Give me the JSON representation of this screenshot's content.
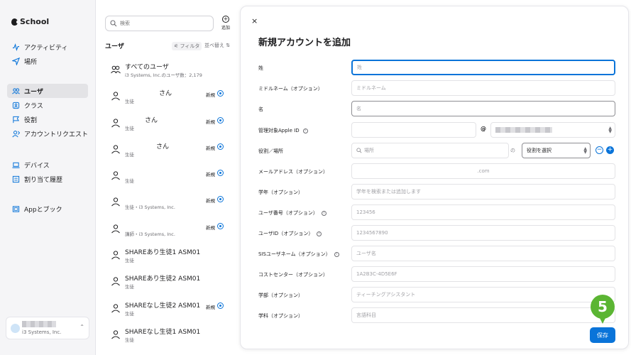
{
  "sidebar": {
    "brand": "School",
    "items": [
      {
        "label": "アクティビティ",
        "icon": "activity-icon"
      },
      {
        "label": "場所",
        "icon": "location-icon"
      },
      {
        "label": "ユーザ",
        "icon": "users-icon",
        "active": true
      },
      {
        "label": "クラス",
        "icon": "class-icon"
      },
      {
        "label": "役割",
        "icon": "flag-icon"
      },
      {
        "label": "アカウントリクエスト",
        "icon": "account-request-icon"
      },
      {
        "label": "デバイス",
        "icon": "laptop-icon"
      },
      {
        "label": "割り当て履歴",
        "icon": "history-icon"
      },
      {
        "label": "Appとブック",
        "icon": "apps-icon"
      }
    ],
    "account": {
      "org": "i3 Systems, Inc."
    }
  },
  "list": {
    "search_placeholder": "検索",
    "add_label": "追加",
    "title": "ユーザ",
    "filter_label": "フィルタ",
    "sort_label": "並べ替え",
    "rows": [
      {
        "name": "すべてのユーザ",
        "sub": "i3 Systems, Inc.のユーザ数：2,179",
        "new": "",
        "group": true
      },
      {
        "name": "さん",
        "sub": "生徒",
        "new": "新規",
        "centered": true
      },
      {
        "name": "さん",
        "sub": "生徒",
        "new": "新規",
        "centered": true
      },
      {
        "name": "さん",
        "sub": "生徒",
        "new": "新規",
        "centered": true
      },
      {
        "name": "",
        "sub": "生徒",
        "new": "新規"
      },
      {
        "name": "",
        "sub": "生徒・i3 Systems, Inc.",
        "new": "新規"
      },
      {
        "name": "",
        "sub": "講師・i3 Systems, Inc.",
        "new": "新規"
      },
      {
        "name": "SHAREあり生徒1 ASM01",
        "sub": "生徒",
        "new": ""
      },
      {
        "name": "SHAREあり生徒2 ASM01",
        "sub": "生徒",
        "new": ""
      },
      {
        "name": "SHAREなし生徒2 ASM01",
        "sub": "生徒",
        "new": "新規"
      },
      {
        "name": "SHAREなし生徒1 ASM01",
        "sub": "生徒",
        "new": ""
      }
    ]
  },
  "modal": {
    "close": "×",
    "title": "新規アカウントを追加",
    "fields": {
      "last_name": {
        "label": "姓",
        "placeholder": "姓"
      },
      "middle_name": {
        "label": "ミドルネーム（オプション）",
        "placeholder": "ミドルネーム"
      },
      "first_name": {
        "label": "名",
        "placeholder": "名"
      },
      "apple_id": {
        "label": "管理対象Apple ID",
        "at": "@"
      },
      "role": {
        "label": "役割／場所",
        "place_placeholder": "場所",
        "no": "の",
        "role_select": "役割を選択"
      },
      "email": {
        "label": "メールアドレス（オプション）",
        "value": ".com"
      },
      "grade": {
        "label": "学年（オプション）",
        "placeholder": "学年を検索または追加します"
      },
      "user_number": {
        "label": "ユーザ番号（オプション）",
        "placeholder": "123456"
      },
      "user_id": {
        "label": "ユーザID（オプション）",
        "placeholder": "1234567890"
      },
      "sis": {
        "label": "SISユーザネーム（オプション）",
        "placeholder": "ユーザ名"
      },
      "cost_center": {
        "label": "コストセンター（オプション）",
        "placeholder": "1A2B3C-4D5E6F"
      },
      "department": {
        "label": "学部（オプション）",
        "placeholder": "ティーチングアシスタント"
      },
      "subject": {
        "label": "学科（オプション）",
        "placeholder": "言語科目"
      }
    },
    "save": "保存"
  },
  "annotation": {
    "step": "5"
  },
  "colors": {
    "accent": "#0a74d9",
    "step": "#5bb533"
  }
}
